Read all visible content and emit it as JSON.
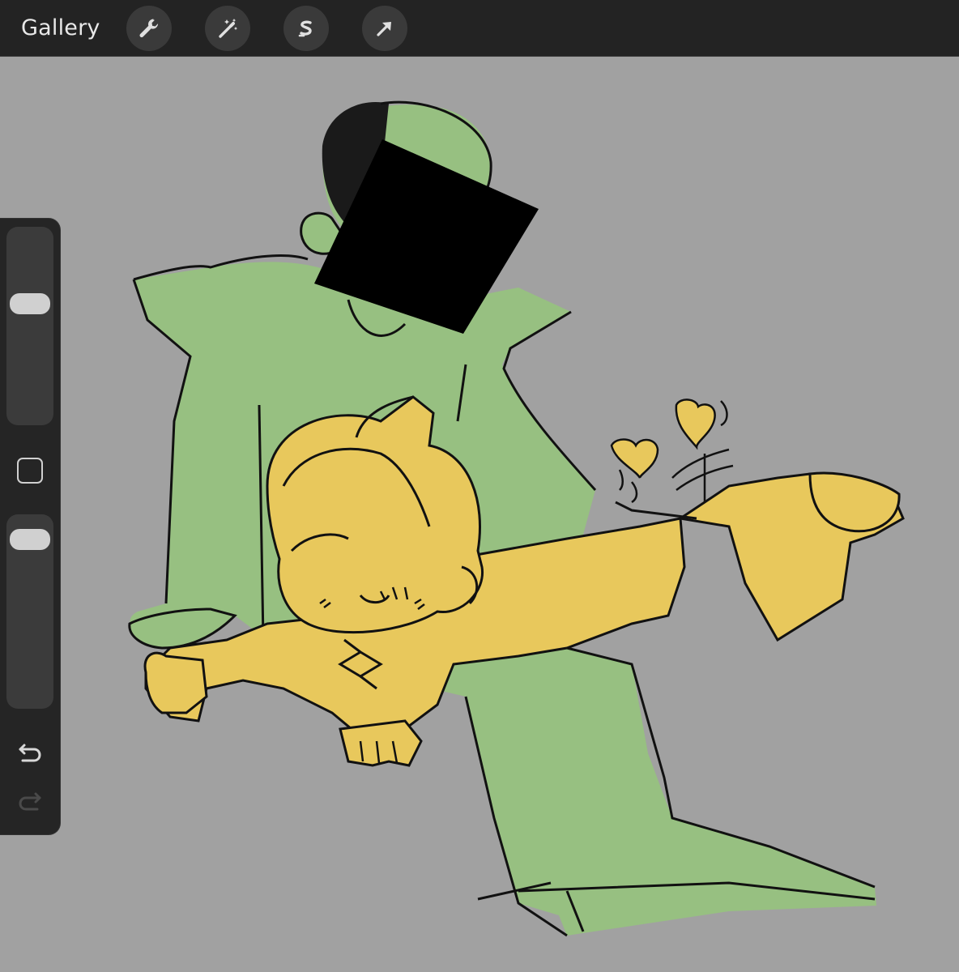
{
  "toolbar": {
    "gallery_label": "Gallery",
    "tools": [
      {
        "name": "actions",
        "icon": "wrench-icon"
      },
      {
        "name": "adjustments",
        "icon": "magic-wand-icon"
      },
      {
        "name": "selection",
        "icon": "selection-s-icon"
      },
      {
        "name": "transform",
        "icon": "arrow-cursor-icon"
      }
    ]
  },
  "sidebar": {
    "brush_size_level": 0.63,
    "opacity_level": 0.93,
    "undo_icon": "undo-icon",
    "redo_icon": "redo-icon"
  },
  "colors": {
    "toolbar_bg": "#232323",
    "canvas_bg": "#a1a1a1",
    "green_fill": "#97c081",
    "yellow_fill": "#e8c85c",
    "ink": "#111111"
  }
}
